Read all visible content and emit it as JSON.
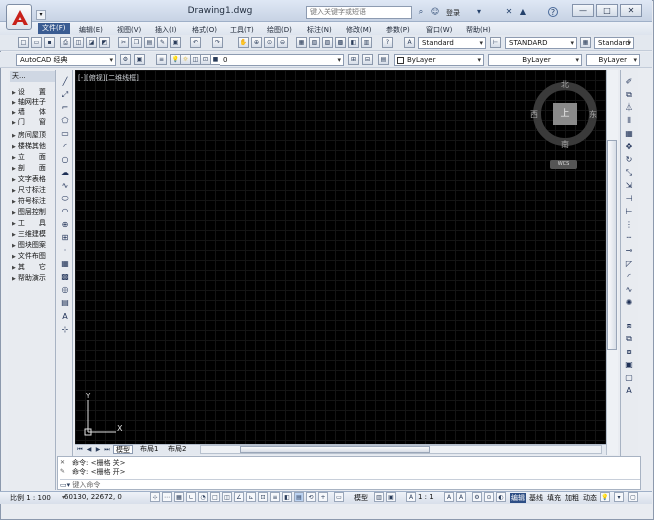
{
  "app": {
    "document_title": "Drawing1.dwg"
  },
  "titlebar": {
    "search_placeholder": "键入关键字或短语",
    "login_label": "登录",
    "help_label": "?"
  },
  "window_controls": {
    "minimize": "—",
    "maximize": "□",
    "close": "✕"
  },
  "menu": [
    "文件(F)",
    "编辑(E)",
    "视图(V)",
    "插入(I)",
    "格式(O)",
    "工具(T)",
    "绘图(D)",
    "标注(N)",
    "修改(M)",
    "参数(P)",
    "窗口(W)",
    "帮助(H)"
  ],
  "toolbar2": {
    "text_style": "Standard",
    "dim_style": "STANDARD",
    "table_style": "Standard"
  },
  "toolbar3": {
    "workspace": "AutoCAD 经典",
    "layer": "0",
    "color": "ByLayer",
    "linetype": "ByLayer",
    "lineweight": "ByLayer"
  },
  "left_panel": {
    "header": "天...",
    "items": [
      "设　　置",
      "轴网柱子",
      "墙　　体",
      "门　　窗",
      "房间屋顶",
      "楼梯其他",
      "立　　面",
      "剖　　面",
      "文字表格",
      "尺寸标注",
      "符号标注",
      "图层控制",
      "工　　具",
      "三维建模",
      "图块图案",
      "文件布图",
      "其　　它",
      "帮助演示"
    ]
  },
  "viewport": {
    "label": "[-][俯视][二维线框]"
  },
  "viewcube": {
    "north": "北",
    "south": "南",
    "east": "东",
    "west": "西",
    "face": "上",
    "wcs": "WCS"
  },
  "ucs": {
    "x": "X",
    "y": "Y"
  },
  "layout_tabs": [
    "模型",
    "布局1",
    "布局2"
  ],
  "command": {
    "history": [
      "命令:  <栅格 关>",
      "命令:  <栅格 开>"
    ],
    "prompt": "键入命令"
  },
  "statusbar": {
    "scale": "比例 1 : 100",
    "coords": "60130,  22672,  0",
    "model": "模型",
    "annotation_scale": "1 : 1",
    "buttons": [
      "编辑",
      "基线",
      "填充",
      "加粗",
      "动态"
    ]
  }
}
